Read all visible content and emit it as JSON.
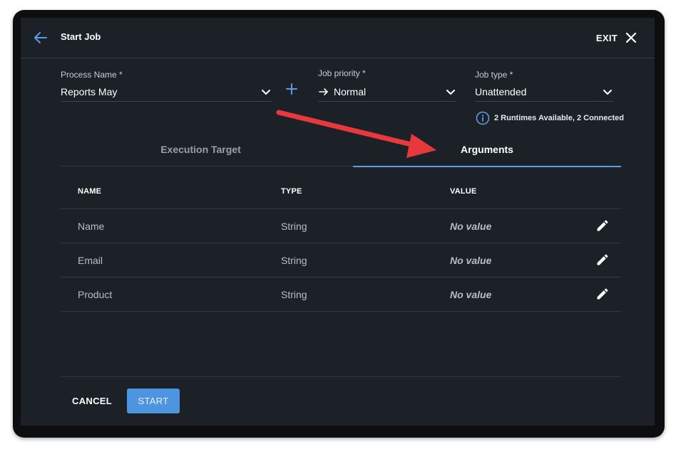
{
  "header": {
    "title": "Start Job",
    "exit_label": "EXIT"
  },
  "form": {
    "process": {
      "label": "Process Name *",
      "value": "Reports May"
    },
    "priority": {
      "label": "Job priority *",
      "value": "Normal"
    },
    "job_type": {
      "label": "Job type *",
      "value": "Unattended"
    },
    "runtime_info": "2 Runtimes Available, 2 Connected"
  },
  "tabs": [
    {
      "label": "Execution Target",
      "active": false
    },
    {
      "label": "Arguments",
      "active": true
    }
  ],
  "table": {
    "columns": [
      "NAME",
      "TYPE",
      "VALUE"
    ],
    "rows": [
      {
        "name": "Name",
        "type": "String",
        "value": "No value"
      },
      {
        "name": "Email",
        "type": "String",
        "value": "No value"
      },
      {
        "name": "Product",
        "type": "String",
        "value": "No value"
      }
    ]
  },
  "footer": {
    "cancel_label": "CANCEL",
    "start_label": "START"
  },
  "colors": {
    "accent": "#5b9ee6",
    "start_button": "#4d95e0",
    "annotation_arrow": "#e8383d",
    "dialog_bg": "#1c2127"
  },
  "icons": [
    "back-arrow-icon",
    "close-icon",
    "chevron-down-icon",
    "plus-icon",
    "arrow-right-icon",
    "info-icon",
    "pencil-icon"
  ]
}
